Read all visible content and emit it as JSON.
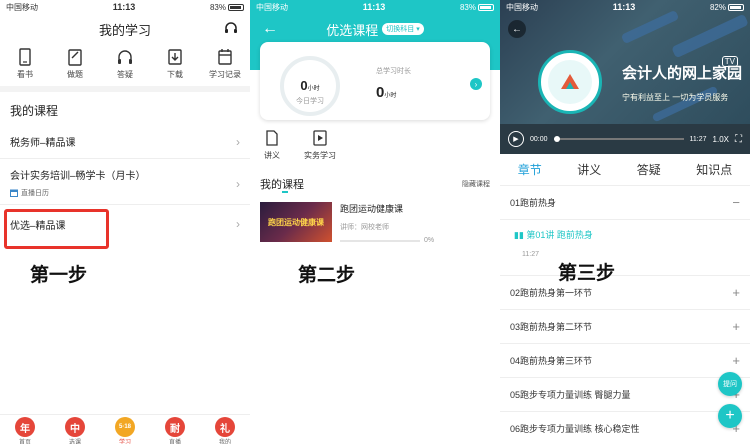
{
  "status1": {
    "carrier": "中国移动",
    "time": "11:13",
    "battery": "83%"
  },
  "status3": {
    "carrier": "中国移动",
    "time": "11:13",
    "battery": "82%"
  },
  "panel1": {
    "title": "我的学习",
    "quick": [
      {
        "label": "看书",
        "icon": "book-icon"
      },
      {
        "label": "做题",
        "icon": "clipboard-icon"
      },
      {
        "label": "答疑",
        "icon": "headphones-icon"
      },
      {
        "label": "下载",
        "icon": "download-icon"
      },
      {
        "label": "学习记录",
        "icon": "calendar-icon"
      }
    ],
    "section": "我的课程",
    "courses": [
      {
        "title": "税务师–精品课",
        "sub": ""
      },
      {
        "title": "会计实务培训–畅学卡（月卡）",
        "sub": "直播日历"
      },
      {
        "title": "优选–精品课",
        "sub": ""
      }
    ],
    "step": "第一步",
    "tabs": [
      {
        "icon": "年",
        "label": "首页"
      },
      {
        "icon": "中",
        "label": "选课"
      },
      {
        "icon": "5·18",
        "label": "学习"
      },
      {
        "icon": "耐",
        "label": "直播"
      },
      {
        "icon": "礼",
        "label": "我的"
      }
    ]
  },
  "panel2": {
    "title": "优选课程",
    "tag": "切换科目",
    "today": {
      "value": "0",
      "unit": "小时",
      "label": "今日学习"
    },
    "total": {
      "label": "总学习时长",
      "value": "0",
      "unit": "小时"
    },
    "tools": [
      {
        "label": "讲义",
        "icon": "document-icon"
      },
      {
        "label": "实务学习",
        "icon": "video-icon"
      }
    ],
    "my_courses": "我的课程",
    "hide": "隐藏课程",
    "course": {
      "title": "跑团运动健康课",
      "teacher": "讲师：网校老师",
      "progress": 0,
      "progress_text": "0%",
      "thumb_text": "跑团运动健康课"
    },
    "step": "第二步"
  },
  "panel3": {
    "video": {
      "brand": "会计人的网上家园",
      "slogan": "宁有利益至上  一切为学员服务",
      "time_current": "00:00",
      "time_total": "11:27",
      "speed": "1.0X"
    },
    "tabs": [
      "章节",
      "讲义",
      "答疑",
      "知识点"
    ],
    "active_tab": "章节",
    "chapters": [
      {
        "title": "01跑前热身",
        "open": true
      },
      {
        "title": "02跑前热身第一环节"
      },
      {
        "title": "03跑前热身第二环节"
      },
      {
        "title": "04跑前热身第三环节"
      },
      {
        "title": "05跑步专项力量训练  臀腿力量"
      },
      {
        "title": "06跑步专项力量训练  核心稳定性"
      }
    ],
    "lesson": {
      "title": "第01讲   跑前热身",
      "duration": "11:27"
    },
    "ask": "提问",
    "add": "+",
    "step": "第三步",
    "accent": "#1ec6c6"
  }
}
